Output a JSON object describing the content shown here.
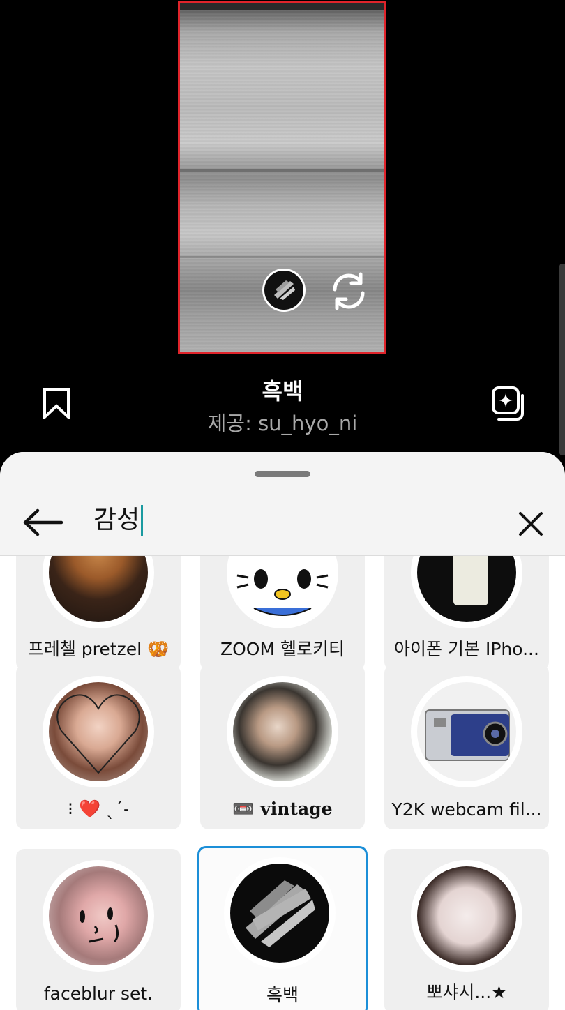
{
  "preview": {
    "title": "흑백",
    "credit": "제공: su_hyo_ni"
  },
  "icons": {
    "bookmark": "bookmark-icon",
    "add_to_story": "add-to-story-icon",
    "flip_camera": "flip-camera-icon",
    "back": "back-arrow-icon",
    "clear": "close-icon"
  },
  "search": {
    "query": "감성"
  },
  "colors": {
    "selection_border": "#1c8fd8",
    "preview_border": "#e0242b",
    "caret": "#1a9aa0"
  },
  "effects": [
    {
      "label": "프레첼 pretzel 🥨"
    },
    {
      "label": "ZOOM 헬로키티"
    },
    {
      "label": "아이폰 기본 IPho..."
    },
    {
      "label": "⁝ ❤️ ˎˊ˗"
    },
    {
      "label": "📼 vintage"
    },
    {
      "label": "Y2K webcam fil..."
    },
    {
      "label": "faceblur set."
    },
    {
      "label": "흑백",
      "selected": true
    },
    {
      "label": "뽀샤시...★"
    }
  ]
}
